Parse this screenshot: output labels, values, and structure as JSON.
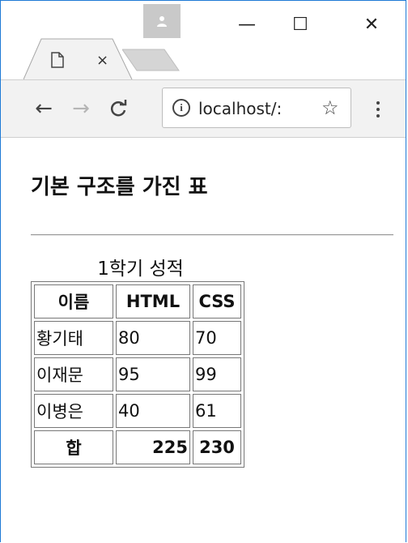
{
  "browser": {
    "tab_title": "",
    "url": "localhost/:",
    "window_controls": {
      "minimize": "—",
      "maximize": "☐",
      "close": "✕"
    },
    "icons": [
      "profile-icon",
      "page-icon",
      "tab-close-icon",
      "back-icon",
      "forward-icon",
      "reload-icon",
      "info-icon",
      "star-icon",
      "menu-icon"
    ]
  },
  "page": {
    "title": "기본 구조를 가진 표",
    "table": {
      "caption": "1학기 성적",
      "headers": [
        "이름",
        "HTML",
        "CSS"
      ],
      "rows": [
        [
          "황기태",
          "80",
          "70"
        ],
        [
          "이재문",
          "95",
          "99"
        ],
        [
          "이병은",
          "40",
          "61"
        ]
      ],
      "footer": [
        "합",
        "225",
        "230"
      ]
    }
  }
}
